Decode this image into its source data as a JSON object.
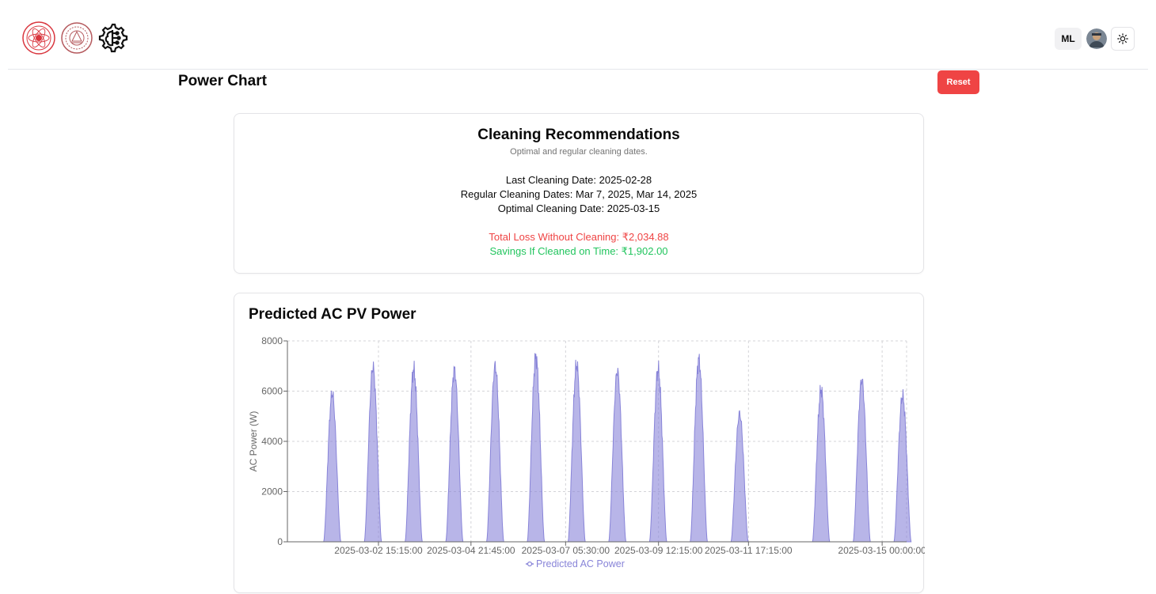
{
  "header": {
    "user_initials": "ML",
    "icons": [
      "institute-emblem-icon",
      "university-seal-icon",
      "ai-gear-icon",
      "sun-icon"
    ]
  },
  "page": {
    "title": "Power Chart",
    "reset_label": "Reset"
  },
  "recommendations": {
    "title": "Cleaning Recommendations",
    "subtitle": "Optimal and regular cleaning dates.",
    "last_cleaning": "Last Cleaning Date: 2025-02-28",
    "regular_dates": "Regular Cleaning Dates: Mar 7, 2025, Mar 14, 2025",
    "optimal_date": "Optimal Cleaning Date: 2025-03-15",
    "total_loss": "Total Loss Without Cleaning: ₹2,034.88",
    "savings": "Savings If Cleaned on Time: ₹1,902.00",
    "colors": {
      "loss": "#ef4444",
      "savings": "#22c55e"
    }
  },
  "chart_data": {
    "type": "area",
    "title": "Predicted AC PV Power",
    "ylabel": "AC Power (W)",
    "xlabel": "",
    "ylim": [
      0,
      8000
    ],
    "yticks": [
      0,
      2000,
      4000,
      6000,
      8000
    ],
    "xticks": [
      "2025-03-02 15:15:00",
      "2025-03-04 21:45:00",
      "2025-03-07 05:30:00",
      "2025-03-09 12:15:00",
      "2025-03-11 17:15:00",
      "2025-03-15 00:00:00"
    ],
    "grid": true,
    "legend": "bottom",
    "series": [
      {
        "name": "Predicted AC Power",
        "color": "#8884d8",
        "fill": "#8884d8",
        "daily_peaks": [
          {
            "day": "2025-03-01",
            "peak": 5900
          },
          {
            "day": "2025-03-02",
            "peak": 6950
          },
          {
            "day": "2025-03-03",
            "peak": 6850
          },
          {
            "day": "2025-03-04",
            "peak": 6850
          },
          {
            "day": "2025-03-05",
            "peak": 7000
          },
          {
            "day": "2025-03-06",
            "peak": 7350
          },
          {
            "day": "2025-03-07",
            "peak": 7050
          },
          {
            "day": "2025-03-08",
            "peak": 6800
          },
          {
            "day": "2025-03-09",
            "peak": 6850
          },
          {
            "day": "2025-03-10",
            "peak": 7250
          },
          {
            "day": "2025-03-11",
            "peak": 5100
          },
          {
            "day": "2025-03-13",
            "peak": 6050
          },
          {
            "day": "2025-03-14",
            "peak": 6450
          },
          {
            "day": "2025-03-15",
            "peak": 5800
          }
        ]
      }
    ]
  }
}
